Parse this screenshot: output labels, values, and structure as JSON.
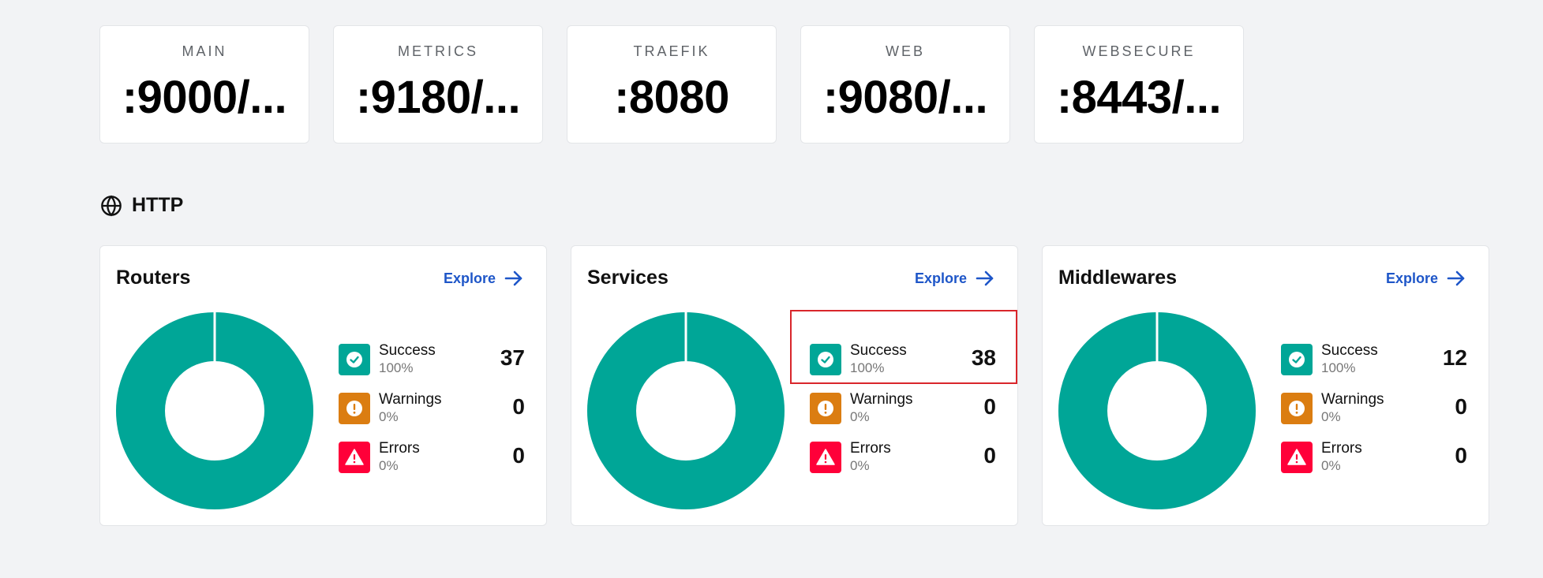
{
  "entrypoints": [
    {
      "name": "MAIN",
      "port": ":9000/..."
    },
    {
      "name": "METRICS",
      "port": ":9180/..."
    },
    {
      "name": "TRAEFIK",
      "port": ":8080"
    },
    {
      "name": "WEB",
      "port": ":9080/..."
    },
    {
      "name": "WEBSECURE",
      "port": ":8443/..."
    }
  ],
  "section": {
    "title": "HTTP",
    "icon": "globe-icon"
  },
  "panels": [
    {
      "title": "Routers",
      "explore_label": "Explore",
      "stats": [
        {
          "label": "Success",
          "percent": "100%",
          "count": "37"
        },
        {
          "label": "Warnings",
          "percent": "0%",
          "count": "0"
        },
        {
          "label": "Errors",
          "percent": "0%",
          "count": "0"
        }
      ],
      "success_fraction": 1.0
    },
    {
      "title": "Services",
      "explore_label": "Explore",
      "stats": [
        {
          "label": "Success",
          "percent": "100%",
          "count": "38"
        },
        {
          "label": "Warnings",
          "percent": "0%",
          "count": "0"
        },
        {
          "label": "Errors",
          "percent": "0%",
          "count": "0"
        }
      ],
      "success_fraction": 1.0
    },
    {
      "title": "Middlewares",
      "explore_label": "Explore",
      "stats": [
        {
          "label": "Success",
          "percent": "100%",
          "count": "12"
        },
        {
          "label": "Warnings",
          "percent": "0%",
          "count": "0"
        },
        {
          "label": "Errors",
          "percent": "0%",
          "count": "0"
        }
      ],
      "success_fraction": 1.0
    }
  ],
  "colors": {
    "success": "#00a697",
    "warning": "#db7d11",
    "error": "#ff0039",
    "link": "#1e56c8",
    "highlight": "#d9262b"
  }
}
